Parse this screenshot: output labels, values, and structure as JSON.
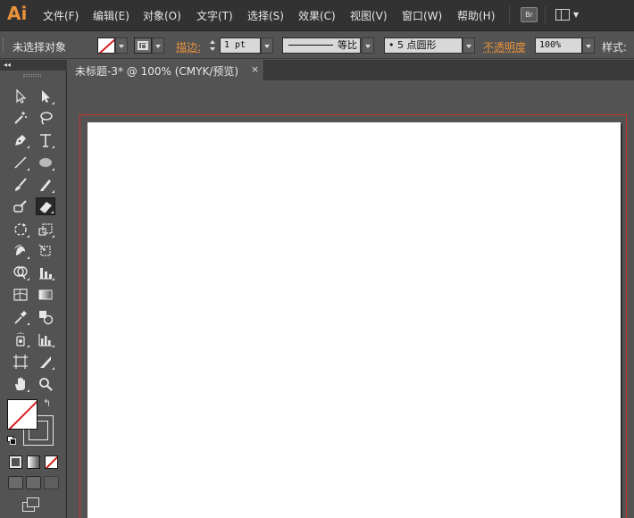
{
  "app": {
    "logo": "Ai"
  },
  "menu": {
    "items": [
      "文件(F)",
      "编辑(E)",
      "对象(O)",
      "文字(T)",
      "选择(S)",
      "效果(C)",
      "视图(V)",
      "窗口(W)",
      "帮助(H)"
    ],
    "bridge_label": "Br"
  },
  "control": {
    "selection_status": "未选择对象",
    "stroke_label": "描边:",
    "stroke_weight": "1 pt",
    "stroke_profile": "等比",
    "brush": "• 5 点圆形",
    "opacity_label": "不透明度",
    "opacity_value": "100%",
    "style_label": "样式:"
  },
  "document": {
    "tab_title": "未标题-3* @ 100% (CMYK/预览)",
    "close_glyph": "×"
  },
  "panel": {
    "collapse_glyph": "◂◂"
  },
  "colors": {
    "accent": "#e8913a",
    "artboard_border": "#c8332a",
    "none_slash": "#d21e1e",
    "ui_background": "#535353",
    "menubar_background": "#323232"
  }
}
